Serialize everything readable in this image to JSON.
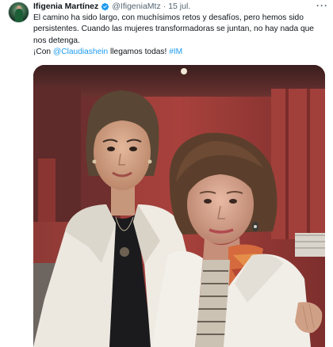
{
  "author": {
    "name": "Ifigenia Martínez",
    "handle": "@IfigeniaMtz",
    "separator": "·",
    "date": "15 jul.",
    "verified_color": "#1d9bf0"
  },
  "more_menu": "···",
  "tweet": {
    "line1": "El camino ha sido largo, con muchísimos retos y desafíos, pero hemos sido persistentes. Cuando las mujeres transformadoras se juntan, no hay nada que nos detenga.",
    "line2_prefix": "¡Con ",
    "mention": "@Claudiashein",
    "line2_middle": " llegamos todas! ",
    "hashtag": "#IM"
  },
  "colors": {
    "link": "#1d9bf0",
    "text": "#0f1419",
    "muted": "#536471"
  }
}
